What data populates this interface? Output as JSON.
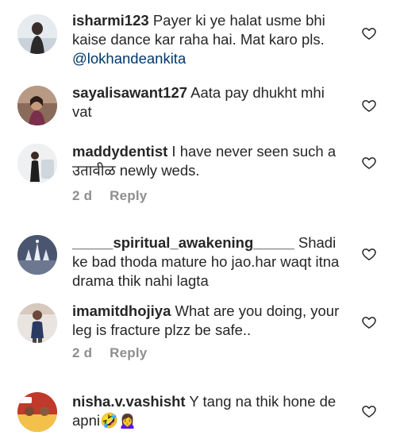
{
  "comments": [
    {
      "username": "isharmi123",
      "text": "Payer ki ye halat usme bhi kaise dance kar raha hai. Mat karo pls.",
      "mention": "@lokhandeankita",
      "avatar_icon": "person-photo-avatar",
      "time": "",
      "reply_label": ""
    },
    {
      "username": "sayalisawant127",
      "text": "Aata pay dhukht mhi vat",
      "avatar_icon": "person-photo-avatar",
      "time": "",
      "reply_label": ""
    },
    {
      "username": "maddydentist",
      "text": "I have never seen such a उतावीळ newly weds.",
      "avatar_icon": "person-photo-avatar",
      "time": "2 d",
      "reply_label": "Reply"
    },
    {
      "username": "_____spiritual_awakening_____",
      "text": "Shadi ke bad thoda mature ho jao.har waqt itna drama thik nahi lagta",
      "avatar_icon": "temple-photo-avatar",
      "time": "",
      "reply_label": ""
    },
    {
      "username": "imamitdhojiya",
      "text": "What are you doing, your leg is fracture plzz be safe..",
      "avatar_icon": "person-photo-avatar",
      "time": "2 d",
      "reply_label": "Reply"
    },
    {
      "username": "nisha.v.vashisht",
      "text": "Y tang na thik hone de apni🤣🙍‍♀️",
      "avatar_icon": "group-photo-avatar",
      "time": "",
      "reply_label": ""
    }
  ],
  "icons": {
    "like": "heart-outline-icon"
  },
  "colors": {
    "text": "#262626",
    "meta": "#8e8e8e",
    "mention": "#00376b"
  }
}
